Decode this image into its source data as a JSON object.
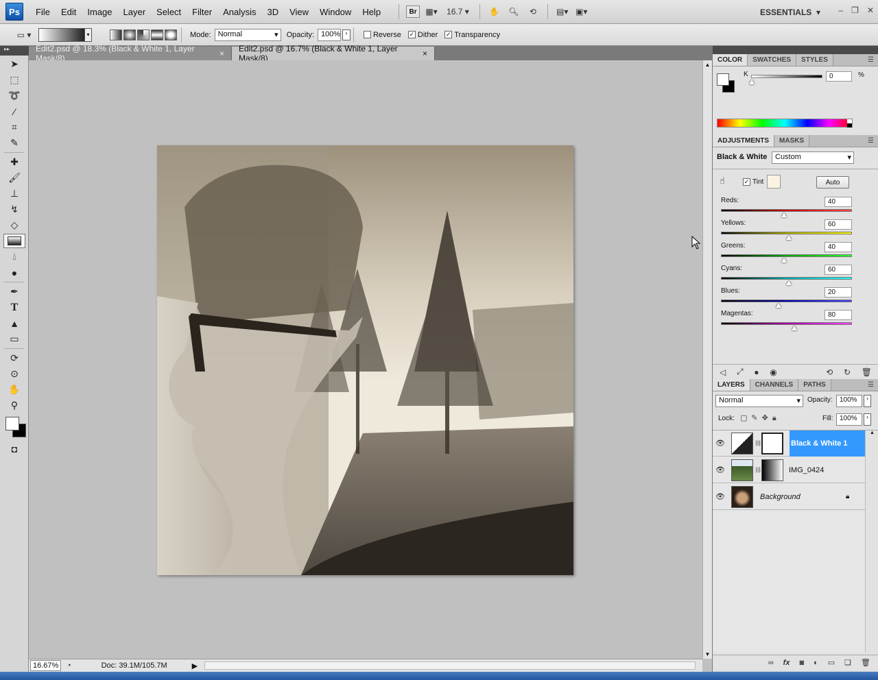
{
  "app": {
    "logo": "Ps",
    "workspace": "ESSENTIALS"
  },
  "menu": [
    "File",
    "Edit",
    "Image",
    "Layer",
    "Select",
    "Filter",
    "Analysis",
    "3D",
    "View",
    "Window",
    "Help"
  ],
  "menubar": {
    "bridge_badge": "Br",
    "zoom": "16.7"
  },
  "options": {
    "mode_label": "Mode:",
    "mode_value": "Normal",
    "opacity_label": "Opacity:",
    "opacity_value": "100%",
    "reverse_label": "Reverse",
    "dither_label": "Dither",
    "transparency_label": "Transparency",
    "reverse_checked": false,
    "dither_checked": true,
    "transparency_checked": true
  },
  "tabs": [
    {
      "label": "Edit2.psd @ 18.3% (Black & White 1, Layer Mask/8)",
      "close": "×",
      "active": false
    },
    {
      "label": "Edit2.psd @ 16.7% (Black & White 1, Layer Mask/8)",
      "close": "×",
      "active": true
    }
  ],
  "status": {
    "zoom": "16.67%",
    "doc": "Doc: 39.1M/105.7M"
  },
  "color_panel": {
    "tabs": [
      "COLOR",
      "SWATCHES",
      "STYLES"
    ],
    "channel_label": "K",
    "channel_value": "0",
    "unit": "%"
  },
  "adjustments": {
    "tabs": [
      "ADJUSTMENTS",
      "MASKS"
    ],
    "title": "Black & White",
    "preset": "Custom",
    "tint_label": "Tint",
    "tint_checked": true,
    "tint_color": "#fbf3e2",
    "auto_label": "Auto",
    "sliders": [
      {
        "label": "Reds:",
        "value": "40",
        "pos": 0.48
      },
      {
        "label": "Yellows:",
        "value": "60",
        "pos": 0.52
      },
      {
        "label": "Greens:",
        "value": "40",
        "pos": 0.48
      },
      {
        "label": "Cyans:",
        "value": "60",
        "pos": 0.52
      },
      {
        "label": "Blues:",
        "value": "20",
        "pos": 0.44
      },
      {
        "label": "Magentas:",
        "value": "80",
        "pos": 0.56
      }
    ]
  },
  "layers_panel": {
    "tabs": [
      "LAYERS",
      "CHANNELS",
      "PATHS"
    ],
    "blend_mode": "Normal",
    "opacity_label": "Opacity:",
    "opacity_value": "100%",
    "lock_label": "Lock:",
    "fill_label": "Fill:",
    "fill_value": "100%",
    "layers": [
      {
        "name": "Black & White 1",
        "selected": true
      },
      {
        "name": "IMG_0424",
        "selected": false
      },
      {
        "name": "Background",
        "selected": false
      }
    ]
  },
  "colors": {
    "accent": "#3a8ee6",
    "selection": "#3399ff",
    "sepia": "#b8a88c"
  }
}
